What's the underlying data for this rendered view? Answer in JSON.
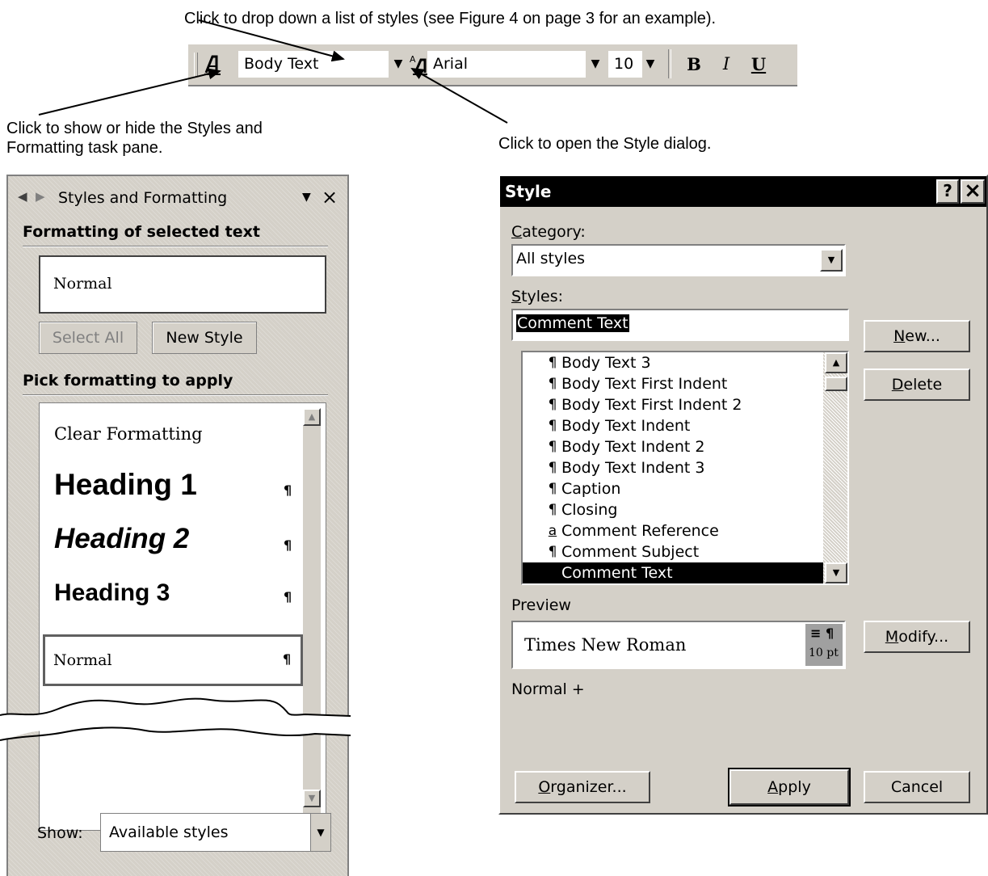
{
  "annotations": {
    "styles_dropdown": "Click to drop down a list of styles (see Figure 4 on page 3 for an example).",
    "task_pane_line1": "Click to show or hide the Styles and",
    "task_pane_line2": "Formatting task pane.",
    "style_dialog": "Click to open the Style dialog."
  },
  "toolbar": {
    "style_value": "Body Text",
    "font_value": "Arial",
    "size_value": "10",
    "bold_label": "B",
    "italic_label": "I",
    "underline_label": "U"
  },
  "task_pane": {
    "title": "Styles and Formatting",
    "formatting_heading": "Formatting of selected text",
    "selected_format": "Normal",
    "select_all_label": "Select All",
    "new_style_label": "New Style",
    "pick_heading": "Pick formatting to apply",
    "styles": [
      {
        "name": "Clear Formatting",
        "mark": ""
      },
      {
        "name": "Heading 1",
        "mark": "¶"
      },
      {
        "name": "Heading 2",
        "mark": "¶"
      },
      {
        "name": "Heading 3",
        "mark": "¶"
      },
      {
        "name": "Normal",
        "mark": "¶"
      }
    ],
    "show_label": "Show:",
    "show_value": "Available styles"
  },
  "style_dialog": {
    "title": "Style",
    "help_label": "?",
    "close_label": "×",
    "category_label": "ategory:",
    "category_accel": "C",
    "category_value": "All styles",
    "styles_label": "tyles:",
    "styles_accel": "S",
    "styles_input_value": "Comment Text",
    "styles_list": [
      {
        "mark": "¶",
        "name": "Body Text 3"
      },
      {
        "mark": "¶",
        "name": "Body Text First Indent"
      },
      {
        "mark": "¶",
        "name": "Body Text First Indent 2"
      },
      {
        "mark": "¶",
        "name": "Body Text Indent"
      },
      {
        "mark": "¶",
        "name": "Body Text Indent 2"
      },
      {
        "mark": "¶",
        "name": "Body Text Indent 3"
      },
      {
        "mark": "¶",
        "name": "Caption"
      },
      {
        "mark": "¶",
        "name": "Closing"
      },
      {
        "mark": "a",
        "name": "Comment Reference"
      },
      {
        "mark": "¶",
        "name": "Comment Subject"
      },
      {
        "mark": "",
        "name": "Comment Text"
      }
    ],
    "preview_label": "Preview",
    "preview_font": "Times New Roman",
    "preview_size": "10 pt",
    "preview_marks": "≡ ¶",
    "description": "Normal +",
    "new_accel": "N",
    "new_label": "ew...",
    "delete_accel": "D",
    "delete_label": "elete",
    "modify_accel": "M",
    "modify_label": "odify...",
    "organizer_accel": "O",
    "organizer_label": "rganizer...",
    "apply_accel": "A",
    "apply_label": "pply",
    "cancel_label": "Cancel"
  }
}
